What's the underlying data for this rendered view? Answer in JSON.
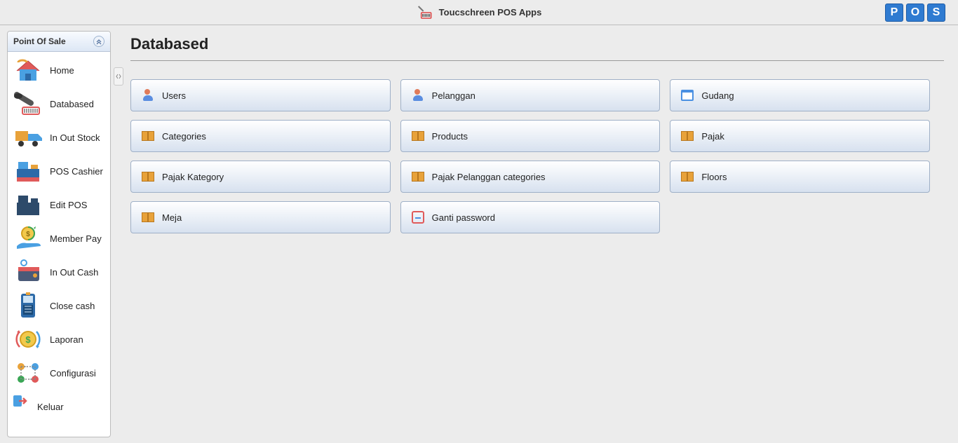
{
  "app": {
    "title": "Toucschreen POS Apps",
    "logoLetters": [
      "P",
      "O",
      "S"
    ]
  },
  "sidebar": {
    "title": "Point Of Sale",
    "items": [
      {
        "label": "Home",
        "icon": "home-icon"
      },
      {
        "label": "Databased",
        "icon": "barcode-icon"
      },
      {
        "label": "In Out Stock",
        "icon": "truck-icon"
      },
      {
        "label": "POS Cashier",
        "icon": "register-icon"
      },
      {
        "label": "Edit POS",
        "icon": "edit-register-icon"
      },
      {
        "label": "Member Pay",
        "icon": "coin-hand-icon"
      },
      {
        "label": "In Out Cash",
        "icon": "wallet-icon"
      },
      {
        "label": "Close cash",
        "icon": "terminal-icon"
      },
      {
        "label": "Laporan",
        "icon": "report-icon"
      },
      {
        "label": "Configurasi",
        "icon": "gear-icon"
      },
      {
        "label": "Keluar",
        "icon": "exit-icon"
      }
    ]
  },
  "page": {
    "title": "Databased",
    "tiles": [
      {
        "label": "Users",
        "icon": "user"
      },
      {
        "label": "Pelanggan",
        "icon": "user"
      },
      {
        "label": "Gudang",
        "icon": "calendar"
      },
      {
        "label": "Categories",
        "icon": "pkg"
      },
      {
        "label": "Products",
        "icon": "pkg"
      },
      {
        "label": "Pajak",
        "icon": "pkg"
      },
      {
        "label": "Pajak Kategory",
        "icon": "pkg"
      },
      {
        "label": "Pajak Pelanggan categories",
        "icon": "pkg"
      },
      {
        "label": "Floors",
        "icon": "pkg"
      },
      {
        "label": "Meja",
        "icon": "pkg"
      },
      {
        "label": "Ganti password",
        "icon": "scan"
      }
    ]
  }
}
